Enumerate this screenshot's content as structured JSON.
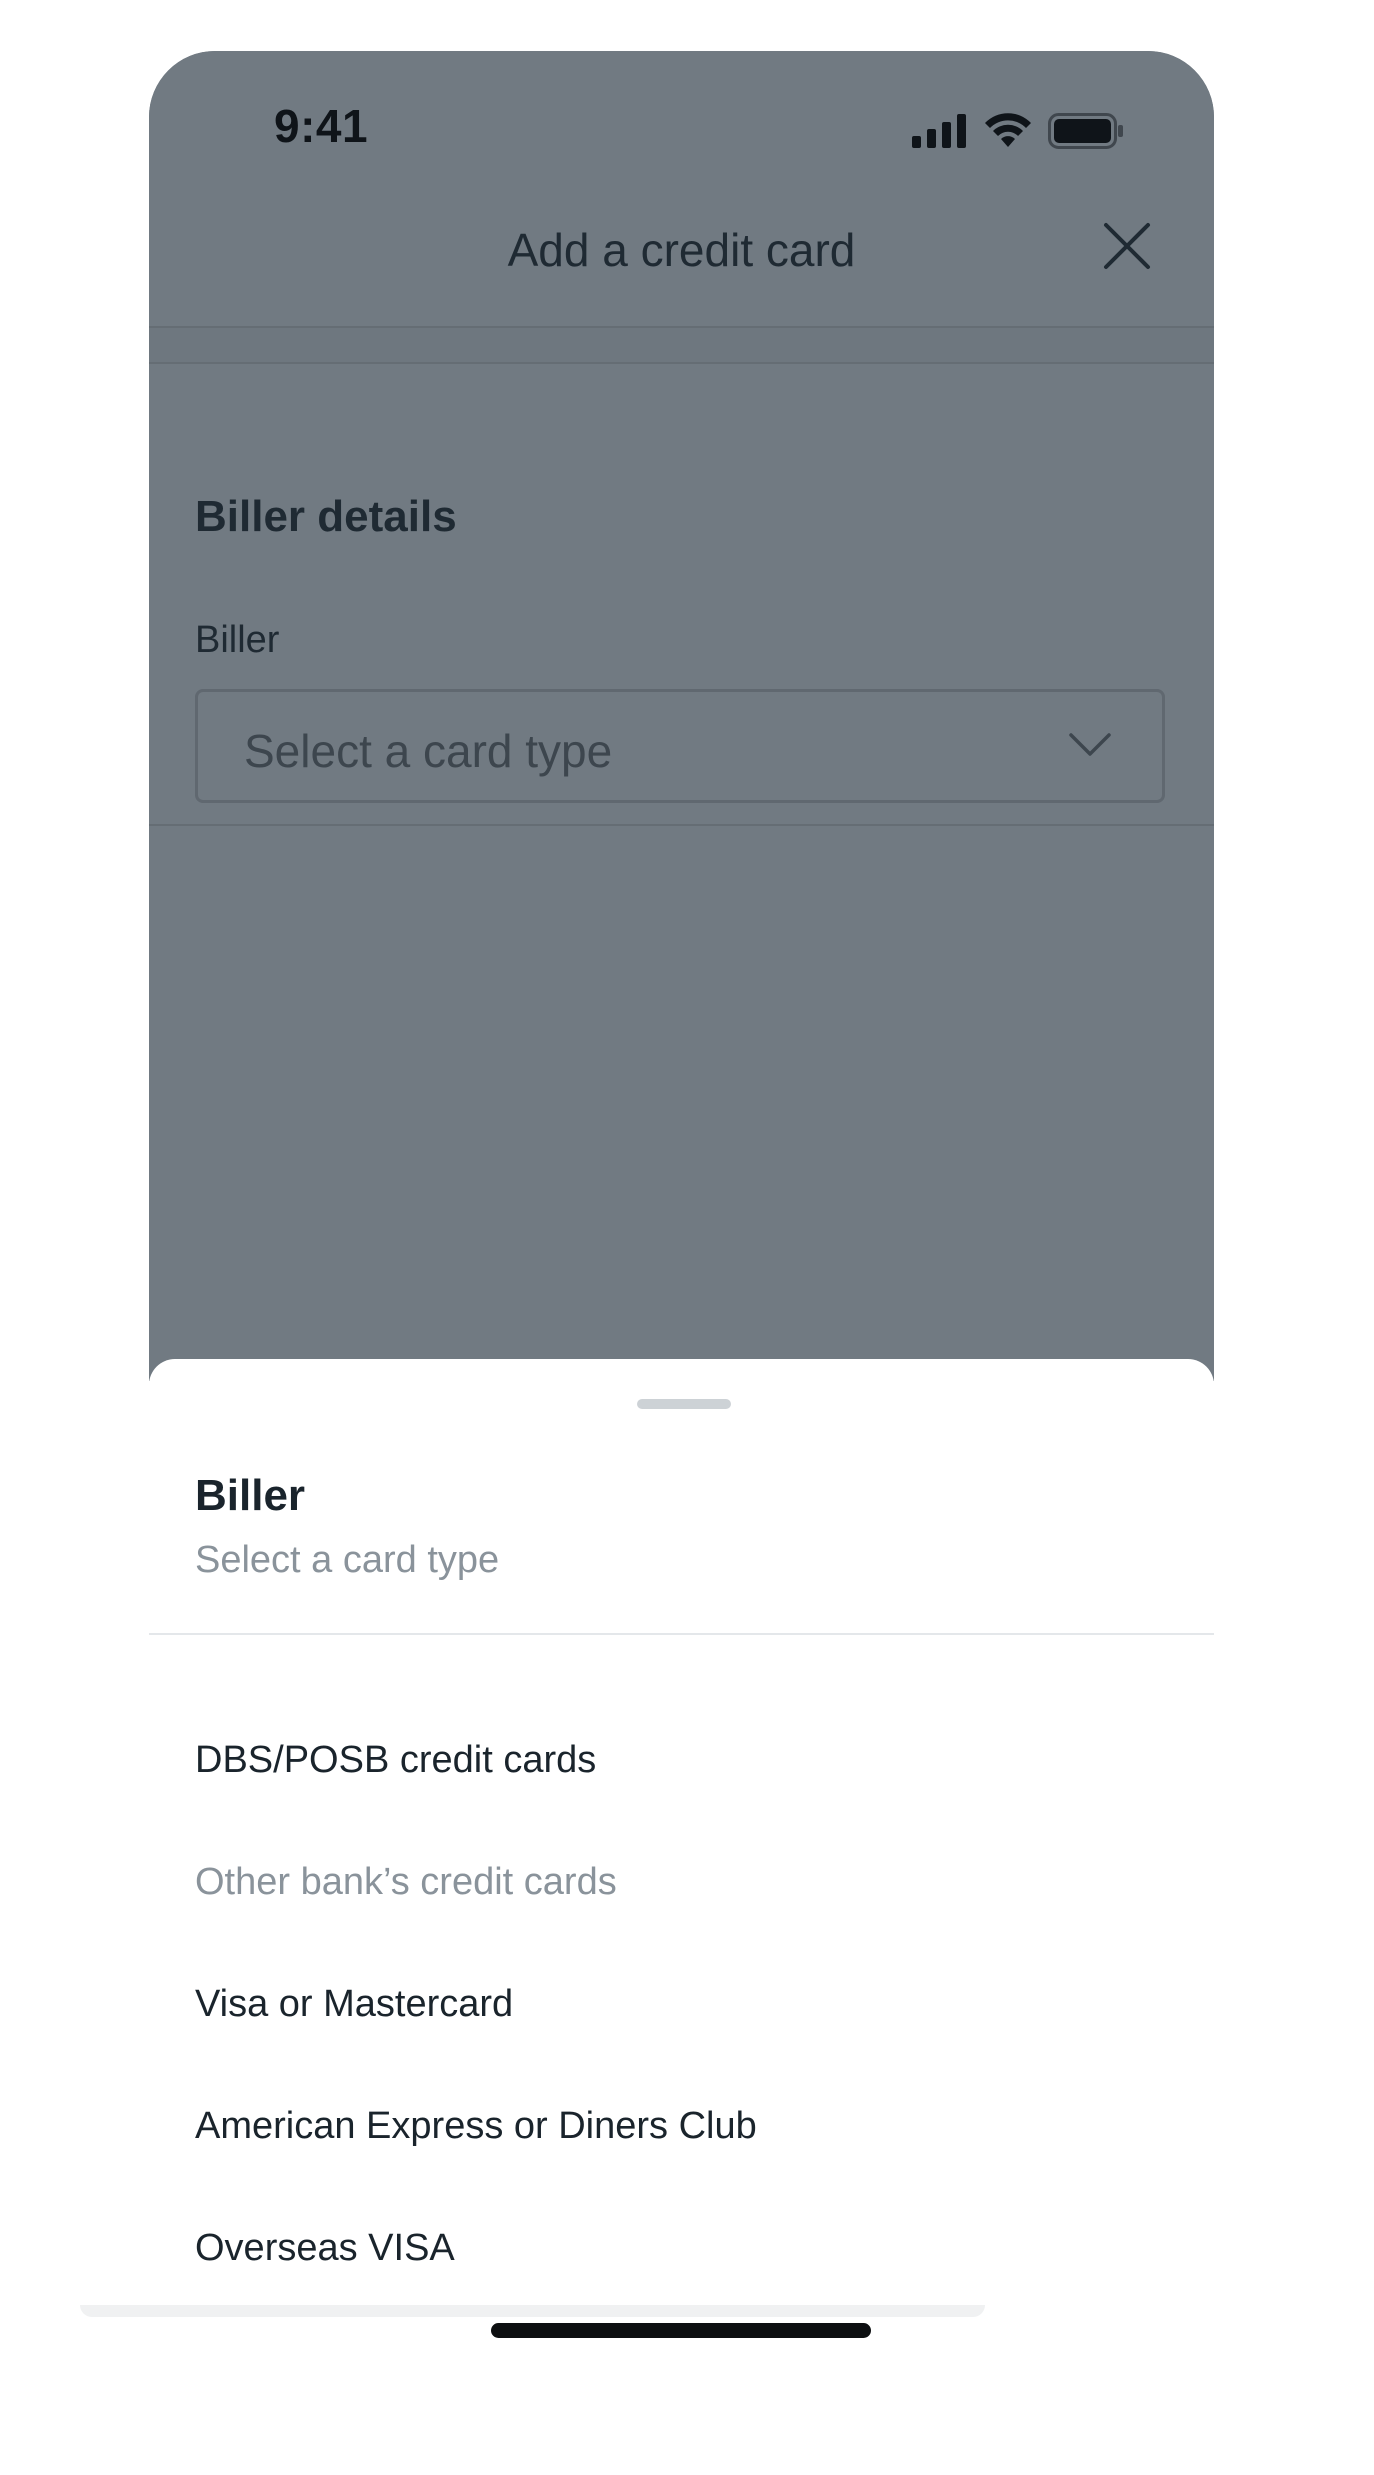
{
  "status_bar": {
    "time": "9:41",
    "icons": [
      "cellular-signal-icon",
      "wifi-icon",
      "battery-icon"
    ]
  },
  "header": {
    "title": "Add a credit card",
    "close_icon": "close-icon"
  },
  "form": {
    "section_title": "Biller details",
    "biller_label": "Biller",
    "biller_placeholder": "Select a card type",
    "chevron_icon": "chevron-down-icon"
  },
  "sheet": {
    "title": "Biller",
    "subtitle": "Select a card type",
    "options": [
      {
        "label": "DBS/POSB credit cards",
        "enabled": true
      },
      {
        "label": "Other bank’s credit cards",
        "enabled": false
      },
      {
        "label": "Visa or Mastercard",
        "enabled": true
      },
      {
        "label": "American Express or Diners Club",
        "enabled": true
      },
      {
        "label": "Overseas VISA",
        "enabled": true
      }
    ]
  },
  "colors": {
    "overlay": "#717a82",
    "text_primary": "#1a242c",
    "text_muted": "#8a939b",
    "sheet_bg": "#ffffff"
  }
}
